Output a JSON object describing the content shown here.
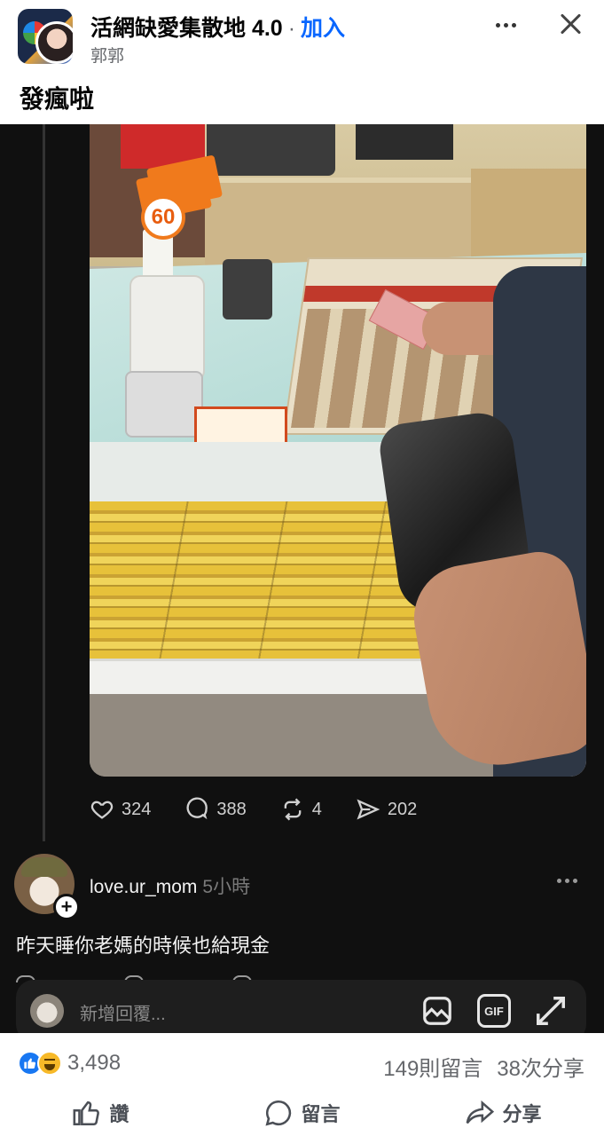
{
  "header": {
    "group_name": "活網缺愛集散地 4.0",
    "separator": "·",
    "join_label": "加入",
    "poster_name": "郭郭",
    "caption": "發瘋啦"
  },
  "threads_post": {
    "actions": [
      {
        "icon": "heart-icon",
        "count": "324"
      },
      {
        "icon": "comment-icon",
        "count": "388"
      },
      {
        "icon": "repost-icon",
        "count": "4"
      },
      {
        "icon": "share-icon",
        "count": "202"
      }
    ],
    "photo_sign_text": "60"
  },
  "comment": {
    "username": "love.ur_mom",
    "time": "5小時",
    "text": "昨天睡你老媽的時候也給現金"
  },
  "reply_bar": {
    "placeholder": "新增回覆...",
    "gif_label": "GIF"
  },
  "footer": {
    "reaction_count": "3,498",
    "comments": "149則留言",
    "shares": "38次分享",
    "like_label": "讚",
    "comment_label": "留言",
    "share_label": "分享"
  },
  "colors": {
    "fb_blue": "#0866ff",
    "dark_bg": "#101010"
  }
}
